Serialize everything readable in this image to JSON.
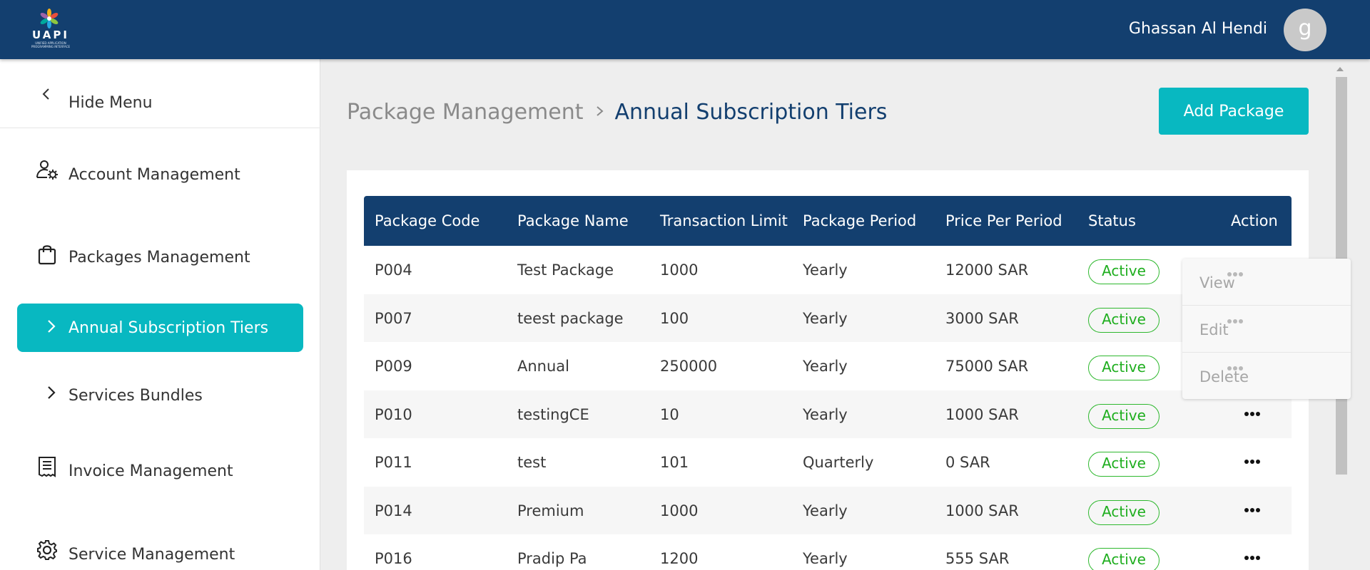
{
  "header": {
    "logo_text": "UAPI",
    "logo_subtitle": "UNIFIED APPLICATION PROGRAMMING INTERFACE",
    "user_name": "Ghassan Al Hendi",
    "avatar_initial": "g"
  },
  "sidebar": {
    "hide_menu_label": "Hide Menu",
    "items": [
      {
        "label": "Account Management",
        "icon": "user-gear-icon"
      },
      {
        "label": "Packages Management",
        "icon": "shopping-bag-icon"
      },
      {
        "label": "Annual Subscription Tiers",
        "icon": "chevron-right-icon",
        "active": true
      },
      {
        "label": "Services Bundles",
        "icon": "chevron-right-icon"
      },
      {
        "label": "Invoice Management",
        "icon": "receipt-icon"
      },
      {
        "label": "Service Management",
        "icon": "gear-icon"
      }
    ]
  },
  "breadcrumb": {
    "parent": "Package Management",
    "current": "Annual Subscription Tiers"
  },
  "add_button_label": "Add Package",
  "table": {
    "columns": [
      "Package Code",
      "Package Name",
      "Transaction Limit",
      "Package Period",
      "Price Per Period",
      "Status",
      "Action"
    ],
    "rows": [
      {
        "code": "P004",
        "name": "Test Package",
        "limit": "1000",
        "period": "Yearly",
        "price": "12000 SAR",
        "status": "Active"
      },
      {
        "code": "P007",
        "name": "teest package",
        "limit": "100",
        "period": "Yearly",
        "price": "3000 SAR",
        "status": "Active"
      },
      {
        "code": "P009",
        "name": "Annual",
        "limit": "250000",
        "period": "Yearly",
        "price": "75000 SAR",
        "status": "Active"
      },
      {
        "code": "P010",
        "name": "testingCE",
        "limit": "10",
        "period": "Yearly",
        "price": "1000 SAR",
        "status": "Active"
      },
      {
        "code": "P011",
        "name": "test",
        "limit": "101",
        "period": "Quarterly",
        "price": "0 SAR",
        "status": "Active"
      },
      {
        "code": "P014",
        "name": "Premium",
        "limit": "1000",
        "period": "Yearly",
        "price": "1000 SAR",
        "status": "Active"
      },
      {
        "code": "P016",
        "name": "Pradip Pa",
        "limit": "1200",
        "period": "Yearly",
        "price": "555 SAR",
        "status": "Active"
      }
    ]
  },
  "action_menu": {
    "items": [
      "View",
      "Edit",
      "Delete"
    ]
  },
  "colors": {
    "navy": "#133f6f",
    "teal": "#08b8c1",
    "status_green": "#2eb82e"
  }
}
